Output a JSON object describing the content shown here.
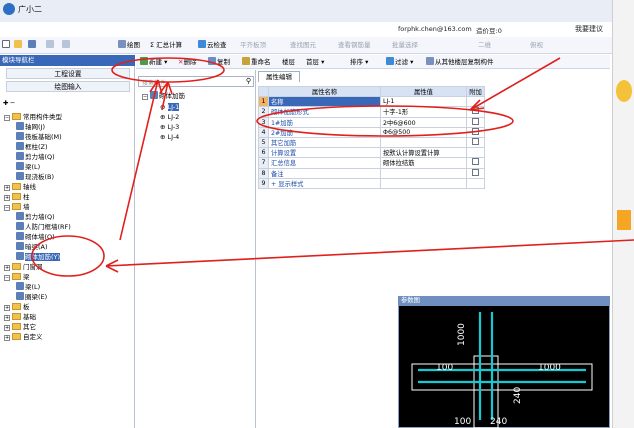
{
  "app": {
    "title": "广小二"
  },
  "topline": {
    "email": "forphk.chen@163.com",
    "credit_label": "造价豆:0",
    "feedback": "我要建议"
  },
  "toolbar": {
    "items": [
      {
        "label": "绘图",
        "icon": "draw-icon"
      },
      {
        "label": "Σ 汇总计算",
        "icon": "sum-icon"
      },
      {
        "label": "云检查",
        "icon": "cloud-check-icon"
      },
      {
        "label": "平齐板顶",
        "icon": "align-icon",
        "disabled": true
      },
      {
        "label": "查找图元",
        "icon": "find-icon",
        "disabled": true
      },
      {
        "label": "查看钢筋量",
        "icon": "steel-icon",
        "disabled": true
      },
      {
        "label": "批量选择",
        "icon": "batch-select-icon",
        "disabled": true
      },
      {
        "label": "二维",
        "icon": "2d-icon",
        "disabled": true
      },
      {
        "label": "俯视",
        "icon": "view-icon",
        "disabled": true
      }
    ],
    "second_items": [
      {
        "label": "新建",
        "icon": "new-icon"
      },
      {
        "label": "删除",
        "icon": "delete-icon"
      },
      {
        "label": "复制",
        "icon": "copy-icon"
      },
      {
        "label": "重命名",
        "icon": "rename-icon"
      },
      {
        "label": "楼层",
        "icon": ""
      },
      {
        "label": "首层",
        "icon": ""
      },
      {
        "label": "排序",
        "icon": "sort-icon"
      },
      {
        "label": "过滤",
        "icon": "filter-icon"
      },
      {
        "label": "从其他楼层复制构件",
        "icon": "copy-floor-icon"
      }
    ]
  },
  "left_panel": {
    "header": "模块导航栏",
    "buttons": [
      "工程设置",
      "绘图输入"
    ],
    "tree": [
      {
        "label": "常用构件类型",
        "level": 0,
        "folder": true,
        "expanded": true
      },
      {
        "label": "轴网(J)",
        "level": 1
      },
      {
        "label": "筏板基础(M)",
        "level": 1
      },
      {
        "label": "框柱(Z)",
        "level": 1
      },
      {
        "label": "剪力墙(Q)",
        "level": 1
      },
      {
        "label": "梁(L)",
        "level": 1
      },
      {
        "label": "现浇板(B)",
        "level": 1
      },
      {
        "label": "轴线",
        "level": 0,
        "folder": true
      },
      {
        "label": "柱",
        "level": 0,
        "folder": true
      },
      {
        "label": "墙",
        "level": 0,
        "folder": true,
        "expanded": true
      },
      {
        "label": "剪力墙(Q)",
        "level": 1
      },
      {
        "label": "人防门框墙(RF)",
        "level": 1
      },
      {
        "label": "砌体墙(Q)",
        "level": 1
      },
      {
        "label": "暗梁(A)",
        "level": 1
      },
      {
        "label": "砌体加筋(Y)",
        "level": 1,
        "selected": true
      },
      {
        "label": "门窗洞",
        "level": 0,
        "folder": true
      },
      {
        "label": "梁",
        "level": 0,
        "folder": true,
        "expanded": true
      },
      {
        "label": "梁(L)",
        "level": 1
      },
      {
        "label": "圈梁(E)",
        "level": 1
      },
      {
        "label": "板",
        "level": 0,
        "folder": true
      },
      {
        "label": "基础",
        "level": 0,
        "folder": true
      },
      {
        "label": "其它",
        "level": 0,
        "folder": true
      },
      {
        "label": "自定义",
        "level": 0,
        "folder": true
      }
    ]
  },
  "mid_panel": {
    "search_placeholder": "搜索构件...",
    "root": "砌体加筋",
    "items": [
      "LJ-1",
      "LJ-2",
      "LJ-3",
      "LJ-4"
    ]
  },
  "props": {
    "tab": "属性编辑",
    "headers": [
      "属性名称",
      "属性值",
      "附加"
    ],
    "rows": [
      {
        "n": "1",
        "name": "名称",
        "value": "LJ-1",
        "check": false
      },
      {
        "n": "2",
        "name": "砌体加筋形式",
        "value": "十字-1形",
        "check": true
      },
      {
        "n": "3",
        "name": "1#加筋",
        "value": "2中6@600",
        "check": true
      },
      {
        "n": "4",
        "name": "2#加筋",
        "value": "Φ6@500",
        "check": true
      },
      {
        "n": "5",
        "name": "其它加筋",
        "value": "",
        "check": true
      },
      {
        "n": "6",
        "name": "计算设置",
        "value": "按默认计算设置计算",
        "check": false
      },
      {
        "n": "7",
        "name": "汇总信息",
        "value": "砌体拉结筋",
        "check": true
      },
      {
        "n": "8",
        "name": "备注",
        "value": "",
        "check": true
      },
      {
        "n": "9",
        "name": "+ 显示样式",
        "value": "",
        "check": false
      }
    ]
  },
  "preview": {
    "title": "参数图",
    "dim_labels": [
      "1000",
      "100",
      "1000",
      "240",
      "100",
      "240"
    ]
  },
  "colors": {
    "accent": "#3a68b8",
    "annotation": "#e0201c",
    "rebar": "#19c9d2"
  }
}
